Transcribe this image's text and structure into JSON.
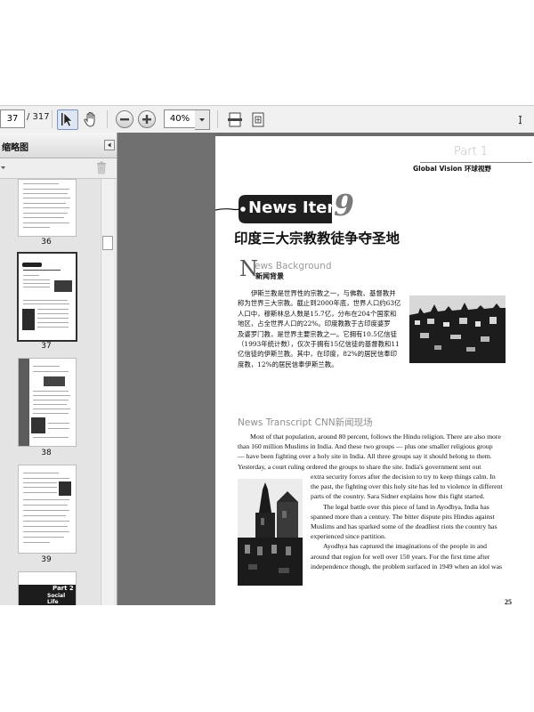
{
  "toolbar": {
    "page_current": "37",
    "page_total": "/ 317",
    "zoom": "40%",
    "icons": [
      "select-arrow-icon",
      "hand-icon",
      "zoom-out-icon",
      "zoom-in-icon",
      "fit-width-icon",
      "fit-page-icon"
    ]
  },
  "sidebar": {
    "title": "缩略图",
    "thumbnails": [
      {
        "label": "36"
      },
      {
        "label": "37",
        "selected": true
      },
      {
        "label": "38"
      },
      {
        "label": "39"
      }
    ],
    "partial_thumb": {
      "line1": "Part 2",
      "line2": "Social Life"
    }
  },
  "document": {
    "part_label": "Part 1",
    "section_title": "Global Vision 环球视野",
    "news_item_label": "News Item",
    "news_item_number": "9",
    "headline": "印度三大宗教教徒争夺圣地",
    "background_heading_en": "ews Background",
    "background_initial": "N",
    "background_heading_cn": "新闻背景",
    "background_cn_lines": [
      "伊斯兰教是世界性的宗教之一，与佛教、基督教并",
      "称为世界三大宗教。截止到2000年底，世界人口约63亿",
      "人口中，穆斯林总人数是15.7亿，分布在204个国家和",
      "地区，占全世界人口的22%。印度教教于古印度婆罗",
      "及婆罗门教，是世界主要宗教之一。它拥有10.5亿信徒",
      "（1993年统计数），仅次于拥有15亿信徒的基督教和11",
      "亿信徒的伊斯兰教。其中，在印度，82%的居民信奉印",
      "度教，12%的居民信奉伊斯兰教。"
    ],
    "transcript_heading": "News Transcript CNN新闻现场",
    "transcript_lines_full": [
      "Most of that population, around 80 percent, follows the Hindu religion. There are also more",
      "than 160 million Muslims in India. And these two groups — plus one smaller religious group",
      "— have been fighting over a holy site in India. All three groups say it should belong to them.",
      "Yesterday, a court ruling ordered the groups to share the site. India's government sent out"
    ],
    "transcript_lines_indented": [
      "extra security forces after the decision to try to keep things calm. In",
      "the past, the fighting over this holy site has led to violence in different",
      "parts of the country. Sara Sidner explains how this fight started.",
      "The legal battle over this piece of land in Ayodhya, India has",
      "spanned more than a century. The bitter dispute pits Hindus against",
      "Muslims and has sparked some of the deadliest riots the country has",
      "experienced since partition.",
      "Ayodhya has captured the imaginations of the people in and",
      "around that region for well over 150 years. For the first time after",
      "independence though, the problem surfaced in 1949 when an idol was"
    ],
    "page_number": "25"
  },
  "colors": {
    "toolbar_bg": "#f0f0f0",
    "viewer_bg": "#707070",
    "tag_bg": "#1f1f1f",
    "thumb_selected_border": "#303030"
  }
}
